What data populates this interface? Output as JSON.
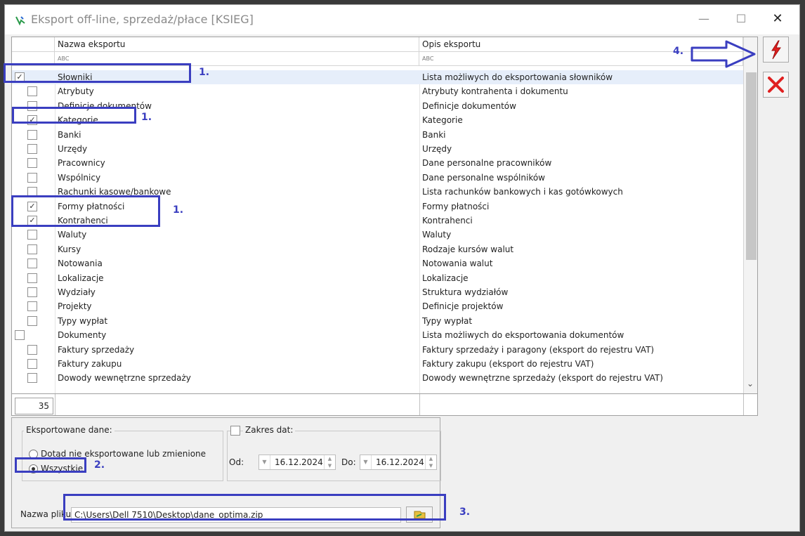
{
  "window": {
    "title": "Eksport off-line, sprzedaż/płace [KSIEG]",
    "minimize_glyph": "—",
    "maximize_glyph": "☐",
    "close_glyph": "✕"
  },
  "grid": {
    "headers": {
      "name": "Nazwa eksportu",
      "description": "Opis eksportu"
    },
    "filter_icon_text": "ABC",
    "rows": [
      {
        "name": "Słowniki",
        "description": "Lista możliwych do eksportowania słowników",
        "checked": true,
        "level": 0
      },
      {
        "name": "Atrybuty",
        "description": "Atrybuty kontrahenta i dokumentu",
        "checked": false,
        "level": 1
      },
      {
        "name": "Definicje dokumentów",
        "description": "Definicje dokumentów",
        "checked": false,
        "level": 1
      },
      {
        "name": "Kategorie",
        "description": "Kategorie",
        "checked": true,
        "level": 1
      },
      {
        "name": "Banki",
        "description": "Banki",
        "checked": false,
        "level": 1
      },
      {
        "name": "Urzędy",
        "description": "Urzędy",
        "checked": false,
        "level": 1
      },
      {
        "name": "Pracownicy",
        "description": "Dane personalne pracowników",
        "checked": false,
        "level": 1
      },
      {
        "name": "Wspólnicy",
        "description": "Dane personalne wspólników",
        "checked": false,
        "level": 1
      },
      {
        "name": "Rachunki kasowe/bankowe",
        "description": "Lista rachunków bankowych i kas gotówkowych",
        "checked": false,
        "level": 1
      },
      {
        "name": "Formy płatności",
        "description": "Formy płatności",
        "checked": true,
        "level": 1
      },
      {
        "name": "Kontrahenci",
        "description": "Kontrahenci",
        "checked": true,
        "level": 1
      },
      {
        "name": "Waluty",
        "description": "Waluty",
        "checked": false,
        "level": 1
      },
      {
        "name": "Kursy",
        "description": "Rodzaje kursów walut",
        "checked": false,
        "level": 1
      },
      {
        "name": "Notowania",
        "description": "Notowania walut",
        "checked": false,
        "level": 1
      },
      {
        "name": "Lokalizacje",
        "description": "Lokalizacje",
        "checked": false,
        "level": 1
      },
      {
        "name": "Wydziały",
        "description": "Struktura wydziałów",
        "checked": false,
        "level": 1
      },
      {
        "name": "Projekty",
        "description": "Definicje projektów",
        "checked": false,
        "level": 1
      },
      {
        "name": "Typy wypłat",
        "description": "Typy wypłat",
        "checked": false,
        "level": 1
      },
      {
        "name": "Dokumenty",
        "description": "Lista możliwych do eksportowania dokumentów",
        "checked": false,
        "level": 0
      },
      {
        "name": "Faktury sprzedaży",
        "description": "Faktury sprzedaży i paragony (eksport do rejestru VAT)",
        "checked": false,
        "level": 1
      },
      {
        "name": "Faktury zakupu",
        "description": "Faktury zakupu  (eksport do rejestru VAT)",
        "checked": false,
        "level": 1
      },
      {
        "name": "Dowody wewnętrzne sprzedaży",
        "description": "Dowody wewnętrzne sprzedaży (eksport do rejestru VAT)",
        "checked": false,
        "level": 1
      }
    ],
    "count": "35"
  },
  "export_data": {
    "legend": "Eksportowane dane:",
    "option_changed": "Dotąd nie eksportowane lub zmienione",
    "option_all": "Wszystkie",
    "selected": "all"
  },
  "date_range": {
    "legend": "Zakres dat:",
    "enabled": false,
    "from_label": "Od:",
    "from_value": "16.12.2024",
    "to_label": "Do:",
    "to_value": "16.12.2024"
  },
  "file": {
    "label": "Nazwa pliku:",
    "value": "C:\\Users\\Dell 7510\\Desktop\\dane_optima.zip"
  },
  "annotations": {
    "step1": "1.",
    "step2": "2.",
    "step3": "3.",
    "step4": "4."
  },
  "colors": {
    "annotation": "#3a3ec0",
    "run_icon": "#e02020",
    "cancel_icon": "#e02020"
  }
}
